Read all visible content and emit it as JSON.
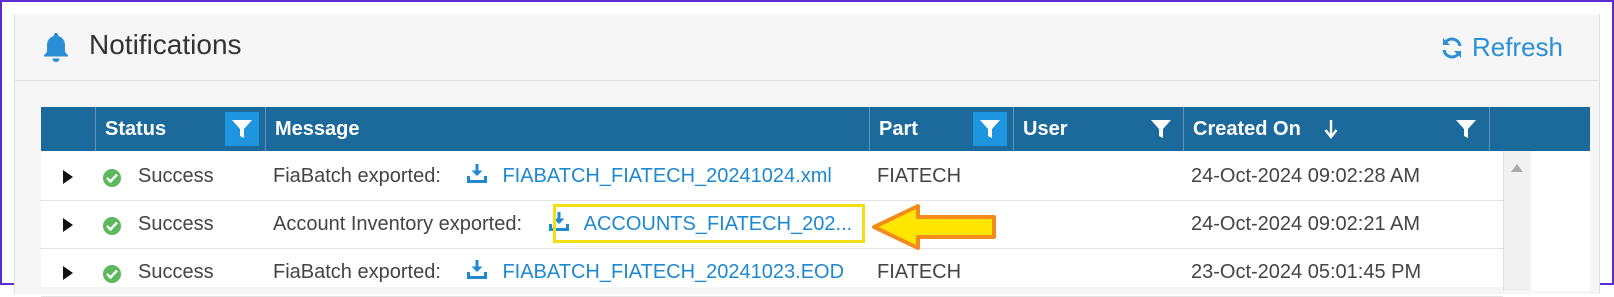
{
  "header": {
    "title": "Notifications",
    "refresh_label": "Refresh",
    "icons": {
      "bell": "bell-icon",
      "refresh": "refresh-icon"
    },
    "accent": "#2a8fd6"
  },
  "grid": {
    "header_bg": "#1b6a9b",
    "columns": [
      {
        "label": "Status",
        "filter_active": true
      },
      {
        "label": "Message",
        "filter_active": false
      },
      {
        "label": "Part",
        "filter_active": true
      },
      {
        "label": "User",
        "filter_active": false
      },
      {
        "label": "Created On",
        "sorted": "descending",
        "filter_active": false
      }
    ],
    "rows": [
      {
        "status": "Success",
        "message_prefix": "FiaBatch exported:",
        "file": "FIABATCH_FIATECH_20241024.xml",
        "part": "FIATECH",
        "user": "",
        "created_on": "24-Oct-2024 09:02:28 AM"
      },
      {
        "status": "Success",
        "message_prefix": "Account Inventory exported:",
        "file": "ACCOUNTS_FIATECH_202...",
        "part": "",
        "user": "",
        "created_on": "24-Oct-2024 09:02:21 AM"
      },
      {
        "status": "Success",
        "message_prefix": "FiaBatch exported:",
        "file": "FIABATCH_FIATECH_20241023.EOD",
        "part": "FIATECH",
        "user": "",
        "created_on": "23-Oct-2024 05:01:45 PM"
      }
    ]
  },
  "annotation": {
    "highlight_color": "#f2e014",
    "arrow_fill": "#ffe600",
    "arrow_stroke": "#f28a1c"
  }
}
